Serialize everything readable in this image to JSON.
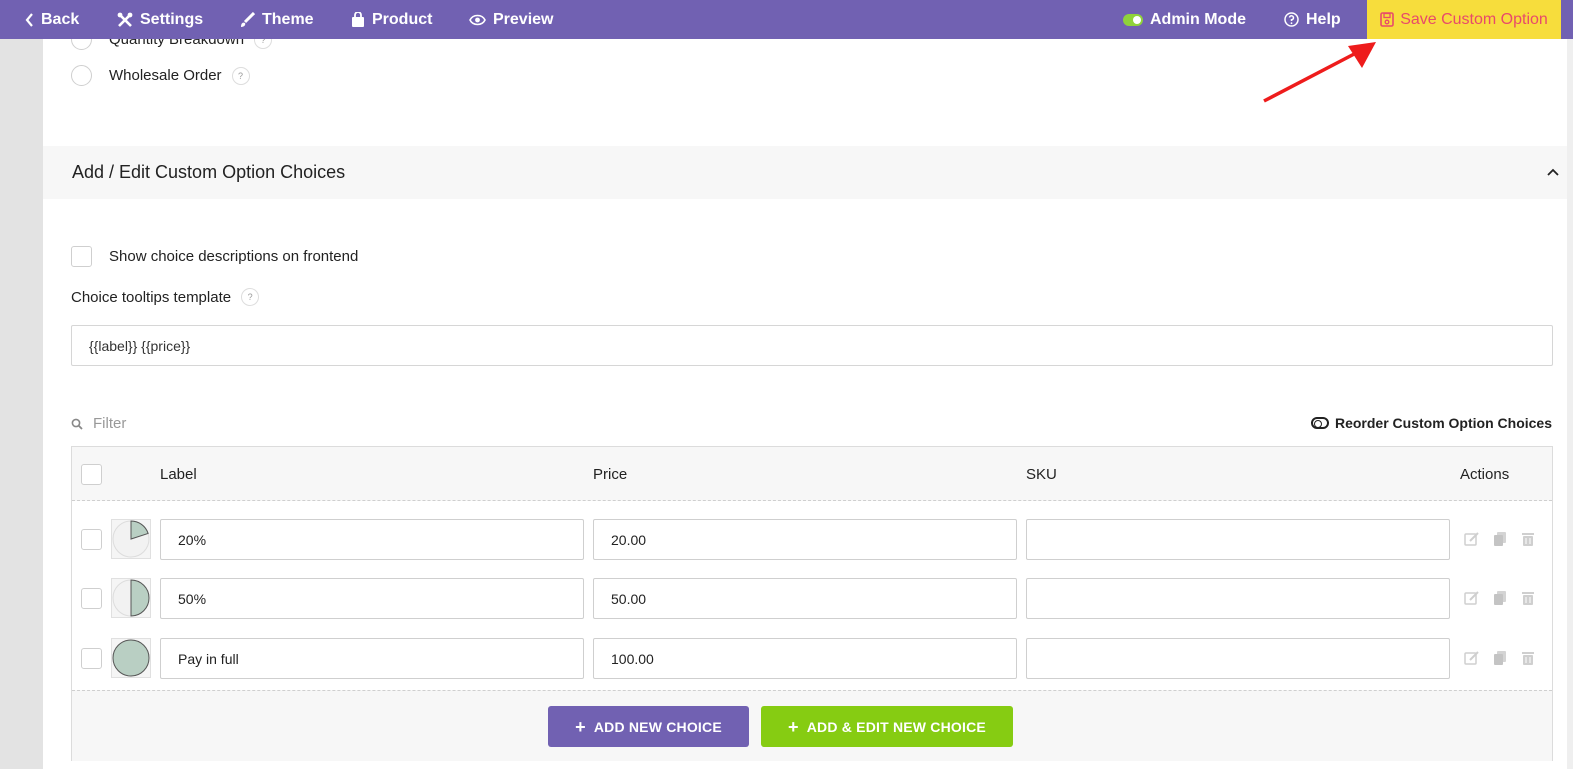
{
  "topbar": {
    "back": "Back",
    "settings": "Settings",
    "theme": "Theme",
    "product": "Product",
    "preview": "Preview",
    "admin_mode": "Admin Mode",
    "help": "Help",
    "save": "Save Custom Option"
  },
  "options": {
    "quantity_breakdown": "Quantity Breakdown",
    "wholesale_order": "Wholesale Order",
    "help_mark": "?"
  },
  "section": {
    "title": "Add / Edit Custom Option Choices"
  },
  "settings": {
    "show_desc_label": "Show choice descriptions on frontend",
    "tooltip_label": "Choice tooltips template",
    "tooltip_value": "{{label}} {{price}}"
  },
  "table": {
    "filter_placeholder": "Filter",
    "reorder_label": "Reorder Custom Option Choices",
    "headers": {
      "label": "Label",
      "price": "Price",
      "sku": "SKU",
      "actions": "Actions"
    },
    "rows": [
      {
        "label": "20%",
        "price": "20.00",
        "sku": "",
        "fill": 0.2
      },
      {
        "label": "50%",
        "price": "50.00",
        "sku": "",
        "fill": 0.5
      },
      {
        "label": "Pay in full",
        "price": "100.00",
        "sku": "",
        "fill": 1.0
      }
    ],
    "add_new": "ADD NEW CHOICE",
    "add_edit_new": "ADD & EDIT NEW CHOICE"
  },
  "colors": {
    "topbar": "#7161b2",
    "save_bg": "#f7dd3c",
    "save_text": "#e84a6a",
    "green": "#86cc12",
    "pie_fill": "#b9cfc3",
    "arrow": "#ee1c1c"
  }
}
